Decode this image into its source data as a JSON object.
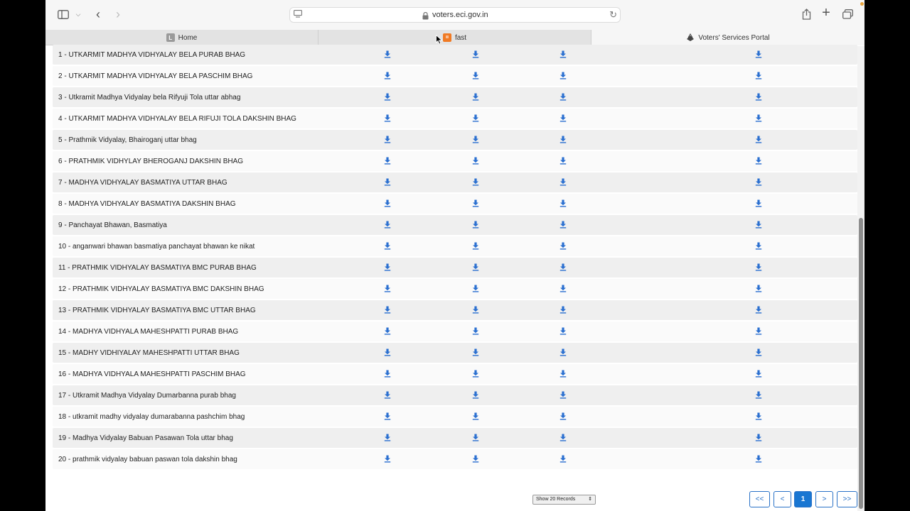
{
  "browser": {
    "url": "voters.eci.gov.in",
    "tabs": [
      {
        "label": "Home",
        "favicon_letter": "L"
      },
      {
        "label": "fast"
      },
      {
        "label": "Voters' Services Portal"
      }
    ]
  },
  "colors": {
    "download_icon": "#2a6fd0",
    "page_active": "#1976d2"
  },
  "rows": [
    "1 - UTKARMIT MADHYA VIDHYALAY BELA PURAB BHAG",
    "2 - UTKARMIT MADHYA VIDHYALAY BELA PASCHIM BHAG",
    "3 - Utkramit Madhya Vidyalay bela Rifyuji Tola uttar abhag",
    "4 - UTKARMIT MADHYA VIDHYALAY BELA RIFUJI TOLA DAKSHIN BHAG",
    "5 - Prathmik Vidyalay, Bhairoganj uttar bhag",
    "6 - PRATHMIK VIDHYLAY BHEROGANJ DAKSHIN BHAG",
    "7 - MADHYA VIDHYALAY BASMATIYA UTTAR BHAG",
    "8 - MADHYA VIDHYALAY BASMATIYA DAKSHIN BHAG",
    "9 - Panchayat Bhawan, Basmatiya",
    "10 - anganwari bhawan basmatiya panchayat bhawan ke nikat",
    "11 - PRATHMIK VIDHYALAY BASMATIYA BMC PURAB BHAG",
    "12 - PRATHMIK VIDHYALAY BASMATIYA BMC DAKSHIN BHAG",
    "13 - PRATHMIK VIDHYALAY BASMATIYA BMC UTTAR BHAG",
    "14 - MADHYA VIDHYALA MAHESHPATTI PURAB BHAG",
    "15 - MADHY VIDHIYALAY MAHESHPATTI UTTAR BHAG",
    "16 - MADHYA VIDHYALA MAHESHPATTI PASCHIM BHAG",
    "17 - Utkramit Madhya Vidyalay Dumarbanna purab bhag",
    "18 - utkramit madhy vidyalay dumarabanna pashchim bhag",
    "19 - Madhya Vidyalay Babuan Pasawan Tola uttar bhag",
    "20 - prathmik vidyalay babuan paswan tola dakshin bhag"
  ],
  "pagination": {
    "records_select": "Show 20 Records",
    "first": "<<",
    "prev": "<",
    "current": "1",
    "next": ">",
    "last": ">>"
  }
}
